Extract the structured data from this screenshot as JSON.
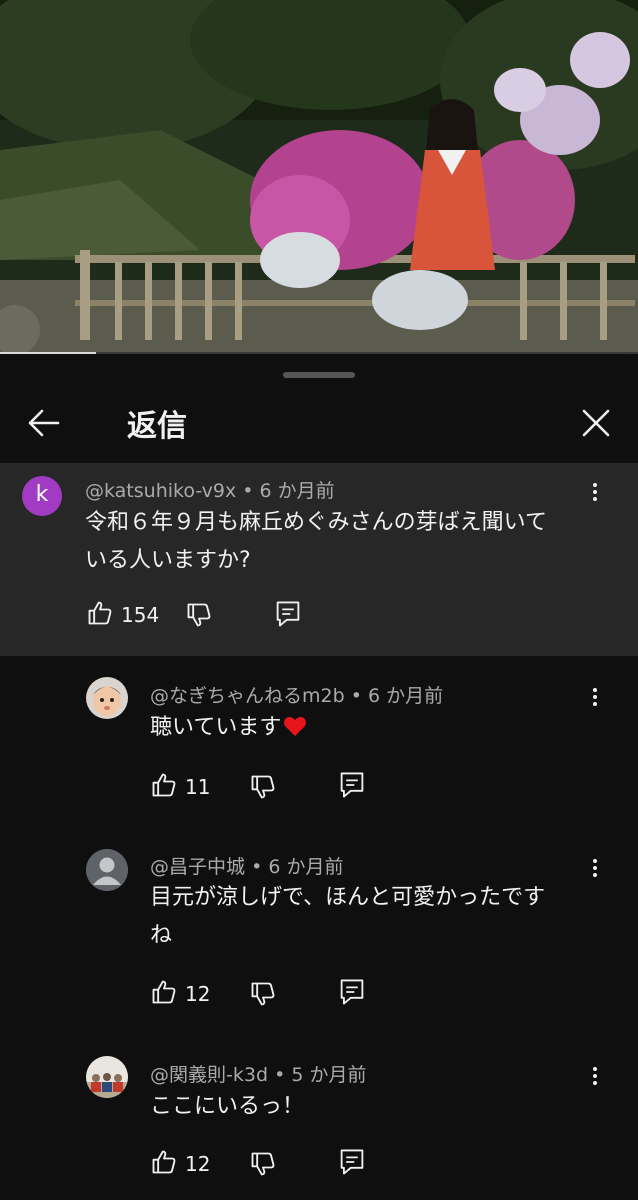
{
  "header": {
    "title": "返信"
  },
  "video": {
    "progress": 0.15
  },
  "parent_comment": {
    "avatar_letter": "k",
    "author": "@katsuhiko-v9x",
    "time": "6 か月前",
    "text_line1": "令和６年９月も麻丘めぐみさんの芽ばえ聞いて",
    "text_line2": "いる人いますか?",
    "likes": "154"
  },
  "replies": [
    {
      "author": "@なぎちゃんねるm2b",
      "time": "6 か月前",
      "text": "聴いています",
      "emoji": "heart-icon",
      "likes": "11"
    },
    {
      "author": "@昌子中城",
      "time": "6 か月前",
      "text_line1": "目元が涼しげで、ほんと可愛かったです",
      "text_line2": "ね",
      "likes": "12"
    },
    {
      "author": "@関義則-k3d",
      "time": "5 か月前",
      "text": "ここにいるっ！",
      "likes": "12"
    }
  ],
  "colors": {
    "avatar_k": "#a23bc4",
    "heart": "#e8141c",
    "background": "#0f0f0f",
    "parent_bg": "#272727"
  }
}
